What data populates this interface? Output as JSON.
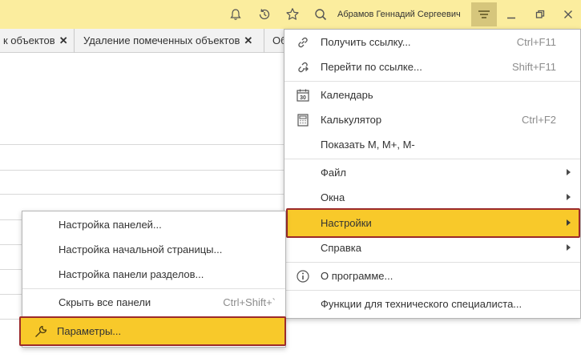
{
  "header": {
    "user_name": "Абрамов Геннадий Сергеевич",
    "icons": [
      "bell-icon",
      "history-icon",
      "star-icon",
      "search-icon",
      "hamburger-menu-icon",
      "minimize-icon",
      "restore-icon",
      "close-icon"
    ]
  },
  "tabs": [
    {
      "label": "к объектов"
    },
    {
      "label": "Удаление помеченных объектов"
    },
    {
      "label": "Об"
    }
  ],
  "main_menu": {
    "items": [
      {
        "label": "Получить ссылку...",
        "shortcut": "Ctrl+F11",
        "icon": "link-icon"
      },
      {
        "label": "Перейти по ссылке...",
        "shortcut": "Shift+F11",
        "icon": "go-to-link-icon"
      },
      {
        "label": "Календарь",
        "icon": "calendar-icon",
        "icon_text": "30"
      },
      {
        "label": "Калькулятор",
        "shortcut": "Ctrl+F2",
        "icon": "calculator-icon"
      },
      {
        "label": "Показать M, M+, M-"
      },
      {
        "label": "Файл",
        "submenu": true
      },
      {
        "label": "Окна",
        "submenu": true
      },
      {
        "label": "Настройки",
        "submenu": true,
        "highlighted": true
      },
      {
        "label": "Справка",
        "submenu": true
      },
      {
        "label": "О программе...",
        "icon": "info-icon"
      },
      {
        "label": "Функции для технического специалиста..."
      }
    ]
  },
  "settings_submenu": {
    "items": [
      {
        "label": "Настройка панелей..."
      },
      {
        "label": "Настройка начальной страницы..."
      },
      {
        "label": "Настройка панели разделов..."
      },
      {
        "label": "Скрыть все панели",
        "shortcut": "Ctrl+Shift+`"
      },
      {
        "label": "Параметры...",
        "icon": "wrench-icon",
        "highlighted": true
      }
    ]
  },
  "colors": {
    "header_bg": "#fbed9e",
    "menu_button_bg": "#d6c67c",
    "highlight_bg": "#f8c92a",
    "highlight_border": "#9c2a2a"
  }
}
